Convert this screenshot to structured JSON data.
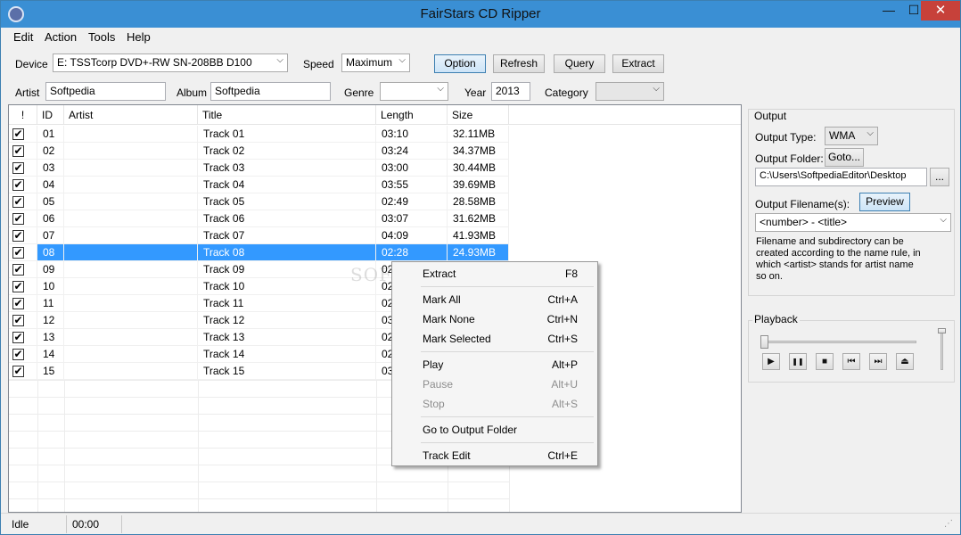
{
  "window": {
    "title": "FairStars CD Ripper",
    "minimize": "—",
    "maximize": "☐",
    "close": "✕"
  },
  "menu": [
    "Edit",
    "Action",
    "Tools",
    "Help"
  ],
  "toolbar": {
    "device_label": "Device",
    "device_value": "E: TSSTcorp DVD+-RW SN-208BB D100",
    "speed_label": "Speed",
    "speed_value": "Maximum",
    "option": "Option",
    "refresh": "Refresh",
    "query": "Query",
    "extract": "Extract"
  },
  "album_info": {
    "artist_label": "Artist",
    "artist_value": "Softpedia",
    "album_label": "Album",
    "album_value": "Softpedia",
    "genre_label": "Genre",
    "genre_value": "",
    "year_label": "Year",
    "year_value": "2013",
    "category_label": "Category",
    "category_value": ""
  },
  "table": {
    "headers": [
      "!",
      "ID",
      "Artist",
      "Title",
      "Length",
      "Size"
    ],
    "rows": [
      {
        "id": "01",
        "artist": "",
        "title": "Track 01",
        "length": "03:10",
        "size": "32.11MB",
        "checked": true
      },
      {
        "id": "02",
        "artist": "",
        "title": "Track 02",
        "length": "03:24",
        "size": "34.37MB",
        "checked": true
      },
      {
        "id": "03",
        "artist": "",
        "title": "Track 03",
        "length": "03:00",
        "size": "30.44MB",
        "checked": true
      },
      {
        "id": "04",
        "artist": "",
        "title": "Track 04",
        "length": "03:55",
        "size": "39.69MB",
        "checked": true
      },
      {
        "id": "05",
        "artist": "",
        "title": "Track 05",
        "length": "02:49",
        "size": "28.58MB",
        "checked": true
      },
      {
        "id": "06",
        "artist": "",
        "title": "Track 06",
        "length": "03:07",
        "size": "31.62MB",
        "checked": true
      },
      {
        "id": "07",
        "artist": "",
        "title": "Track 07",
        "length": "04:09",
        "size": "41.93MB",
        "checked": true
      },
      {
        "id": "08",
        "artist": "",
        "title": "Track 08",
        "length": "02:28",
        "size": "24.93MB",
        "checked": true,
        "selected": true
      },
      {
        "id": "09",
        "artist": "",
        "title": "Track 09",
        "length": "02",
        "size": "",
        "checked": true
      },
      {
        "id": "10",
        "artist": "",
        "title": "Track 10",
        "length": "02",
        "size": "",
        "checked": true
      },
      {
        "id": "11",
        "artist": "",
        "title": "Track 11",
        "length": "02",
        "size": "",
        "checked": true
      },
      {
        "id": "12",
        "artist": "",
        "title": "Track 12",
        "length": "03",
        "size": "",
        "checked": true
      },
      {
        "id": "13",
        "artist": "",
        "title": "Track 13",
        "length": "02",
        "size": "",
        "checked": true
      },
      {
        "id": "14",
        "artist": "",
        "title": "Track 14",
        "length": "02",
        "size": "",
        "checked": true
      },
      {
        "id": "15",
        "artist": "",
        "title": "Track 15",
        "length": "03",
        "size": "",
        "checked": true
      }
    ]
  },
  "context_menu": [
    {
      "label": "Extract",
      "shortcut": "F8",
      "disabled": false
    },
    {
      "separator": true
    },
    {
      "label": "Mark All",
      "shortcut": "Ctrl+A",
      "disabled": false
    },
    {
      "label": "Mark None",
      "shortcut": "Ctrl+N",
      "disabled": false
    },
    {
      "label": "Mark Selected",
      "shortcut": "Ctrl+S",
      "disabled": false
    },
    {
      "separator": true
    },
    {
      "label": "Play",
      "shortcut": "Alt+P",
      "disabled": false
    },
    {
      "label": "Pause",
      "shortcut": "Alt+U",
      "disabled": true
    },
    {
      "label": "Stop",
      "shortcut": "Alt+S",
      "disabled": true
    },
    {
      "separator": true
    },
    {
      "label": "Go to Output Folder",
      "shortcut": "",
      "disabled": false
    },
    {
      "separator": true
    },
    {
      "label": "Track Edit",
      "shortcut": "Ctrl+E",
      "disabled": false
    }
  ],
  "output": {
    "group_title": "Output",
    "type_label": "Output Type:",
    "type_value": "WMA",
    "folder_label": "Output Folder:",
    "goto": "Goto...",
    "folder_value": "C:\\Users\\SoftpediaEditor\\Desktop",
    "browse": "...",
    "filename_label": "Output Filename(s):",
    "preview": "Preview",
    "filename_value": "<number> - <title>",
    "help_text": "Filename and subdirectory can be created according to the name rule, in which <artist> stands for artist name so on."
  },
  "playback": {
    "group_title": "Playback",
    "play": "▶",
    "pause": "❚❚",
    "stop": "■",
    "prev": "⏮",
    "next": "⏭",
    "eject": "⏏",
    "position": 0,
    "volume": 1
  },
  "status": {
    "state": "Idle",
    "time": "00:00"
  },
  "watermark": "SOFTPEDIA"
}
